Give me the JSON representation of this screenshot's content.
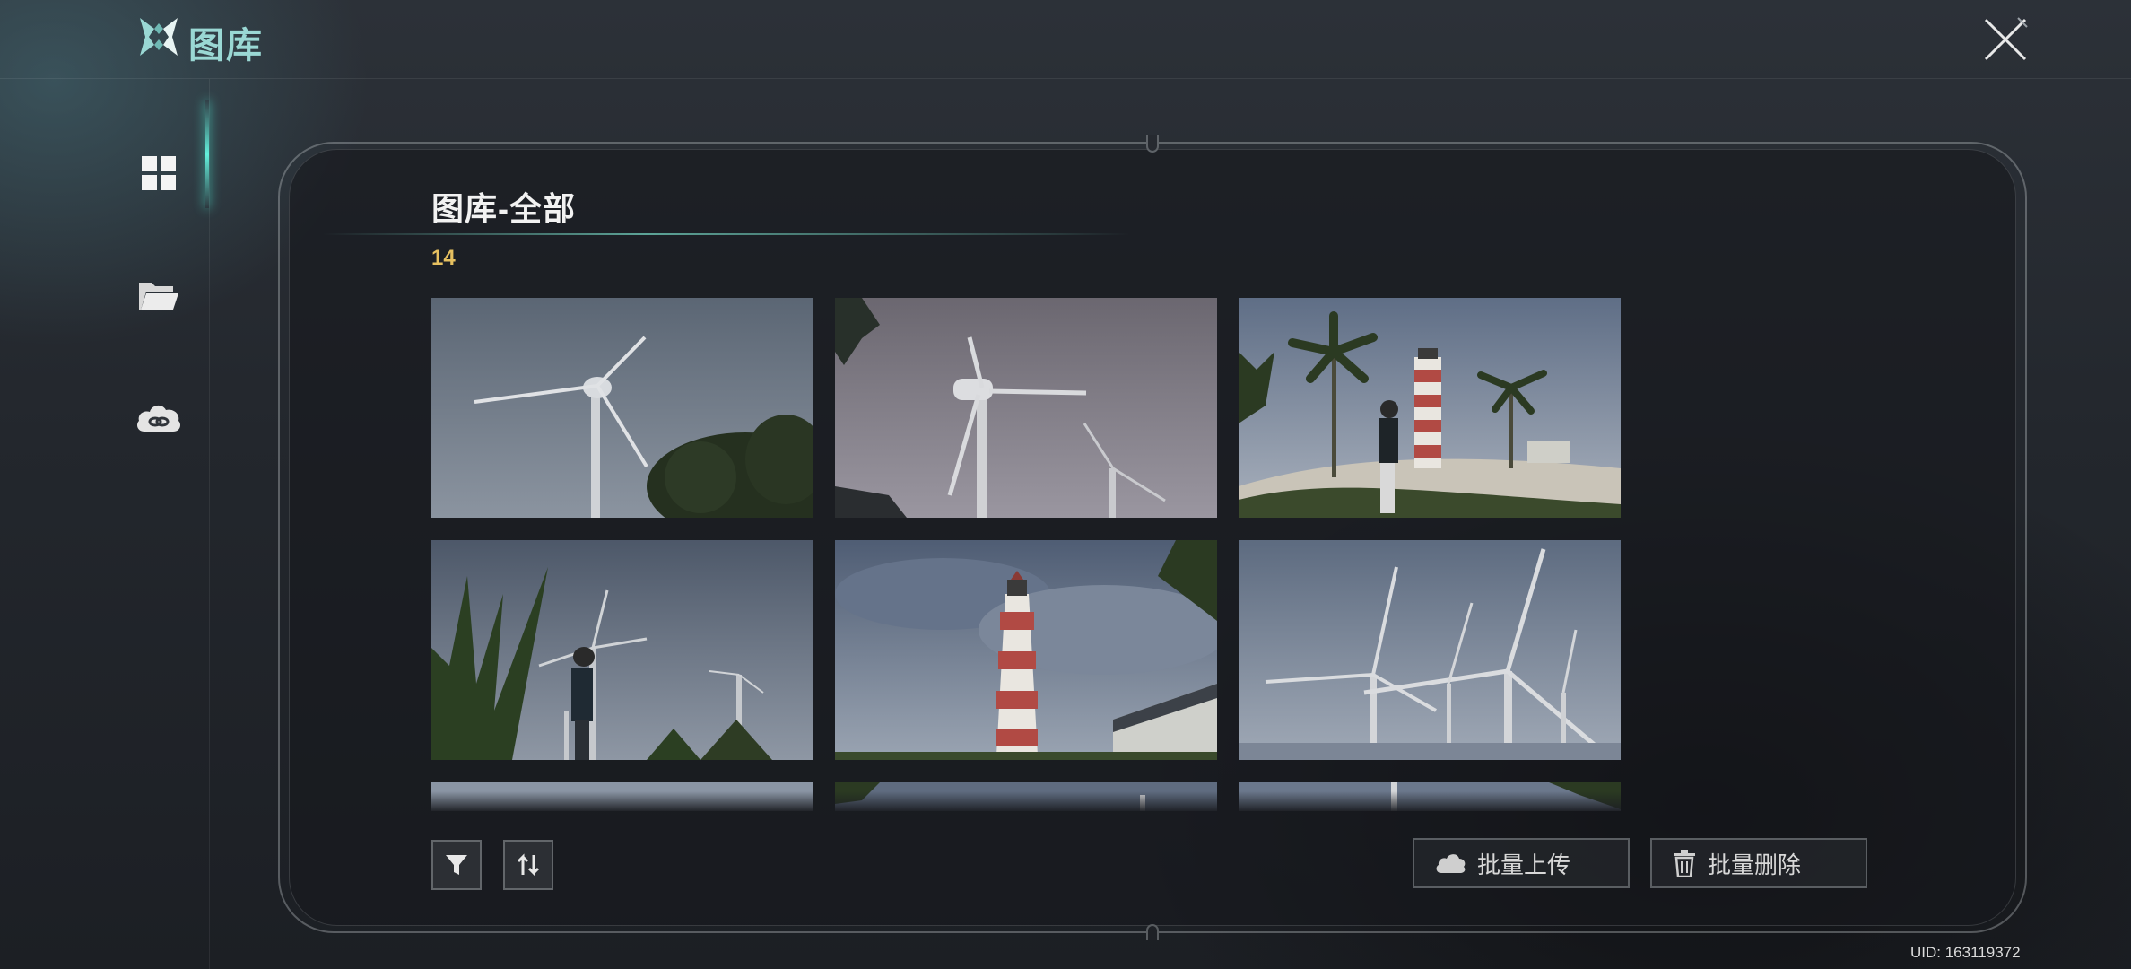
{
  "app": {
    "title": "图库"
  },
  "sidebar": {
    "items": [
      {
        "name": "grid",
        "icon": "grid-icon",
        "active": true
      },
      {
        "name": "folder",
        "icon": "folder-icon",
        "active": false
      },
      {
        "name": "cloud",
        "icon": "cloud-link-icon",
        "active": false
      }
    ]
  },
  "gallery": {
    "title": "图库-全部",
    "count": "14",
    "thumbnails": [
      {
        "scene": "wind-turbine-trees"
      },
      {
        "scene": "wind-turbines-overcast"
      },
      {
        "scene": "lighthouse-palms-character"
      },
      {
        "scene": "character-turbines-grass"
      },
      {
        "scene": "lighthouse-closeup"
      },
      {
        "scene": "wind-farm"
      },
      {
        "scene": "partial"
      },
      {
        "scene": "partial"
      },
      {
        "scene": "partial"
      }
    ]
  },
  "toolbar": {
    "filter_icon": "filter-icon",
    "sort_icon": "sort-icon",
    "batch_upload_label": "批量上传",
    "batch_delete_label": "批量删除"
  },
  "footer": {
    "uid": "UID: 163119372"
  },
  "colors": {
    "accent": "#63f0dc",
    "count": "#e6c060",
    "title": "#9ad8d4"
  }
}
